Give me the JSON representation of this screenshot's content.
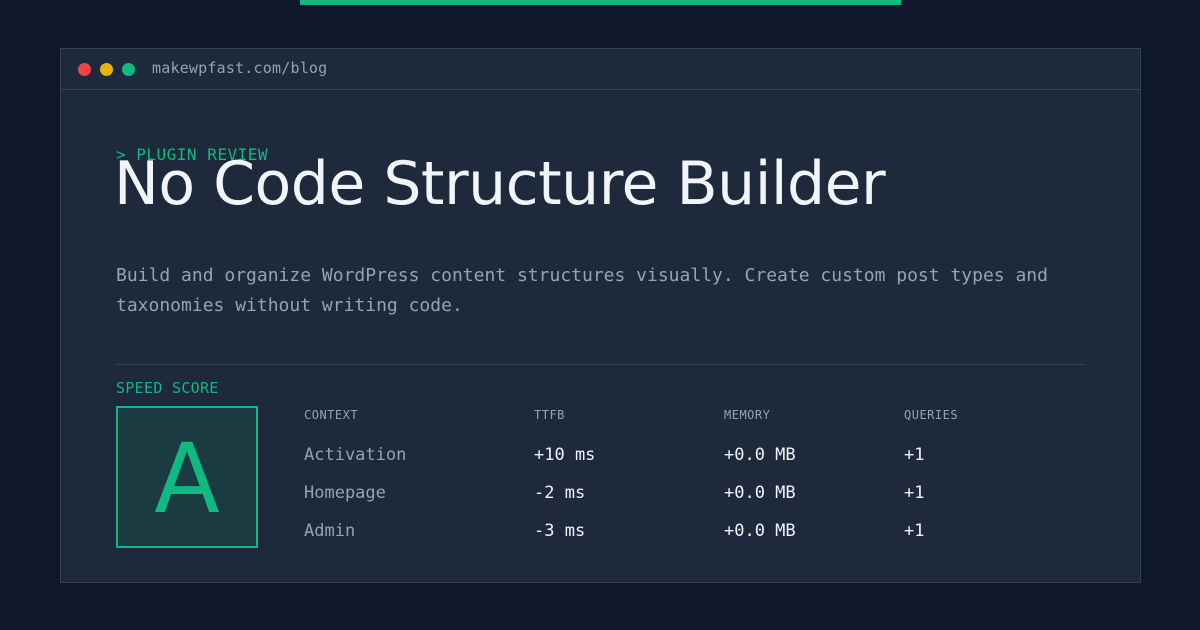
{
  "colors": {
    "accent": "#10b981",
    "window_close": "#ef4444",
    "window_minimize": "#eab308",
    "window_maximize": "#10b981"
  },
  "browser": {
    "url": "makewpfast.com/blog"
  },
  "header": {
    "eyebrow": "> PLUGIN REVIEW",
    "title": "No Code Structure Builder",
    "description": "Build and organize WordPress content structures visually. Create custom post types and taxonomies without writing code."
  },
  "score": {
    "label": "SPEED SCORE",
    "grade": "A"
  },
  "metrics": {
    "headers": [
      "CONTEXT",
      "TTFB",
      "MEMORY",
      "QUERIES"
    ],
    "rows": [
      [
        "Activation",
        "+10 ms",
        "+0.0 MB",
        "+1"
      ],
      [
        "Homepage",
        "-2 ms",
        "+0.0 MB",
        "+1"
      ],
      [
        "Admin",
        "-3 ms",
        "+0.0 MB",
        "+1"
      ]
    ]
  }
}
